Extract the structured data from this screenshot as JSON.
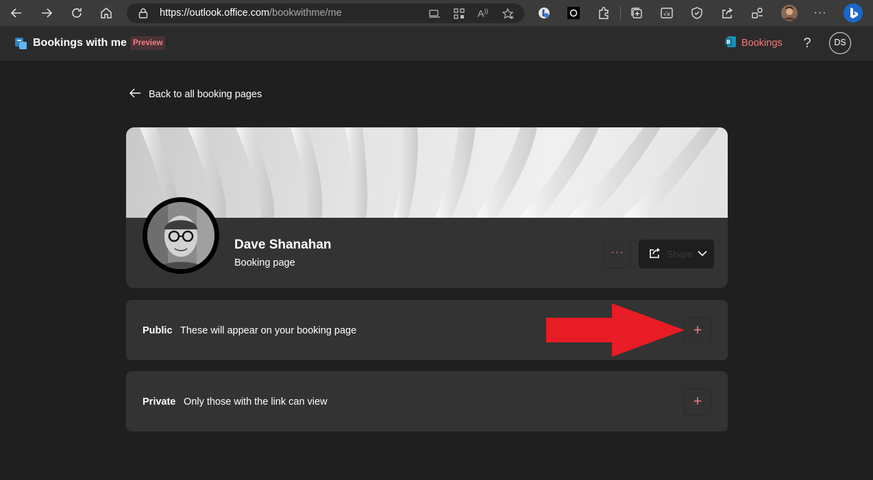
{
  "browser": {
    "url_host": "https://outlook.office.com",
    "url_path": "/bookwithme/me"
  },
  "app": {
    "title": "Bookings with me",
    "badge": "Preview",
    "bookings_link": "Bookings",
    "help": "?",
    "user_initials": "DS"
  },
  "page": {
    "back_link": "Back to all booking pages"
  },
  "profile": {
    "name": "Dave Shanahan",
    "subtitle": "Booking page",
    "more_label": "···",
    "share_label": "Share"
  },
  "sections": [
    {
      "title": "Public",
      "description": "These will appear on your booking page",
      "add_label": "+"
    },
    {
      "title": "Private",
      "description": "Only those with the link can view",
      "add_label": "+"
    }
  ],
  "colors": {
    "accent": "#f27a80",
    "background": "#1f1f1f",
    "card": "#333333",
    "arrow": "#e81c24"
  }
}
